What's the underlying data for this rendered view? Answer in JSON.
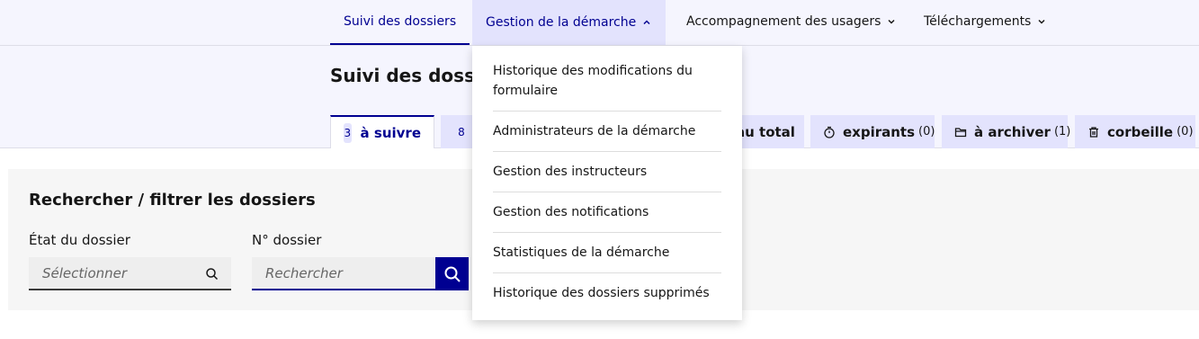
{
  "nav": {
    "items": [
      {
        "label": "Suivi des dossiers"
      },
      {
        "label": "Gestion de la démarche"
      },
      {
        "label": "Accompagnement des usagers"
      },
      {
        "label": "Téléchargements"
      }
    ]
  },
  "page": {
    "title": "Suivi des dossiers"
  },
  "tabs": {
    "a_suivre": {
      "count": "3",
      "label": "à suivre"
    },
    "second": {
      "count": "8"
    },
    "total": {
      "label": "au total"
    },
    "expirants": {
      "label": "expirants",
      "count": "(0)",
      "icon": "timer-icon"
    },
    "a_archiver": {
      "label": "à archiver",
      "count": "(1)",
      "icon": "folder-icon"
    },
    "corbeille": {
      "label": "corbeille",
      "count": "(0)",
      "icon": "trash-icon"
    }
  },
  "search": {
    "title": "Rechercher / filtrer les dossiers",
    "state_label": "État du dossier",
    "state_placeholder": "Sélectionner",
    "number_label": "N° dossier",
    "number_placeholder": "Rechercher"
  },
  "dropdown": {
    "items": [
      {
        "label": "Historique des modifications du formulaire"
      },
      {
        "label": "Administrateurs de la démarche"
      },
      {
        "label": "Gestion des instructeurs"
      },
      {
        "label": "Gestion des notifications"
      },
      {
        "label": "Statistiques de la démarche"
      },
      {
        "label": "Historique des dossiers supprimés"
      }
    ]
  },
  "colors": {
    "accent": "#000091",
    "tab_background": "#e3e3fd",
    "header_background": "#f5f5fe"
  }
}
